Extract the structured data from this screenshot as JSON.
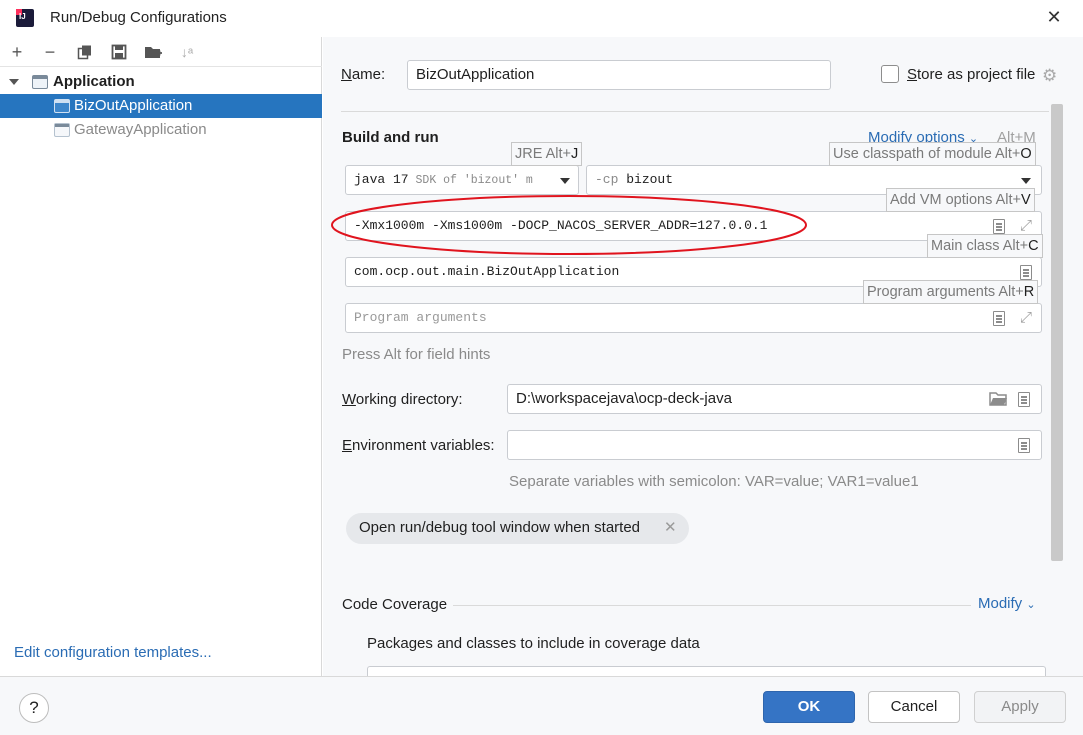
{
  "window": {
    "title": "Run/Debug Configurations",
    "logo_icon": "intellij-idea-icon",
    "close_icon": "close-icon"
  },
  "left_toolbar": {
    "icons": [
      "add-icon",
      "remove-icon",
      "copy-icon",
      "save-icon",
      "new-folder-icon",
      "sort-icon"
    ]
  },
  "tree": {
    "group": {
      "label": "Application",
      "expanded": true
    },
    "items": [
      {
        "label": "BizOutApplication",
        "selected": true
      },
      {
        "label": "GatewayApplication",
        "selected": false
      }
    ]
  },
  "edit_templates_link": "Edit configuration templates...",
  "name_section": {
    "label_prefix": "N",
    "label_rest": "ame:",
    "value": "BizOutApplication",
    "store_checkbox": {
      "checked": false,
      "label_prefix": "S",
      "label_rest": "tore as project file"
    }
  },
  "build_and_run": {
    "title": "Build and run",
    "modify_options": "Modify options",
    "modify_options_shortcut": "Alt+M",
    "jre": {
      "main": "java 17",
      "detail": " SDK of 'bizout' m"
    },
    "classpath": {
      "prefix": "-cp ",
      "module": "bizout"
    },
    "vm_options": "-Xmx1000m -Xms1000m -DOCP_NACOS_SERVER_ADDR=127.0.0.1",
    "main_class": "com.ocp.out.main.BizOutApplication",
    "program_args_placeholder": "Program arguments",
    "press_alt_hint": "Press Alt for field hints",
    "hints": {
      "jre": {
        "text": "JRE Alt+",
        "key": "J"
      },
      "classpath": {
        "text": "Use classpath of module Alt+",
        "key": "O"
      },
      "vm": {
        "text": "Add VM options Alt+",
        "key": "V"
      },
      "main_class": {
        "text": "Main class Alt+",
        "key": "C"
      },
      "program_args": {
        "text": "Program arguments Alt+",
        "key": "R"
      }
    }
  },
  "working_directory": {
    "label_prefix": "W",
    "label_rest": "orking directory:",
    "value": "D:\\workspacejava\\ocp-deck-java"
  },
  "environment_variables": {
    "label_prefix": "E",
    "label_rest": "nvironment variables:",
    "value": "",
    "hint": "Separate variables with semicolon: VAR=value; VAR1=value1"
  },
  "chip": {
    "label": "Open run/debug tool window when started"
  },
  "code_coverage": {
    "title": "Code Coverage",
    "modify": "Modify",
    "packages_label": "Packages and classes to include in coverage data"
  },
  "buttons": {
    "help": "?",
    "ok": "OK",
    "cancel": "Cancel",
    "apply": "Apply"
  },
  "colors": {
    "accent": "#3574c5",
    "selection": "#2675bf",
    "link": "#2a6cb4",
    "annotation": "#e0141e"
  }
}
